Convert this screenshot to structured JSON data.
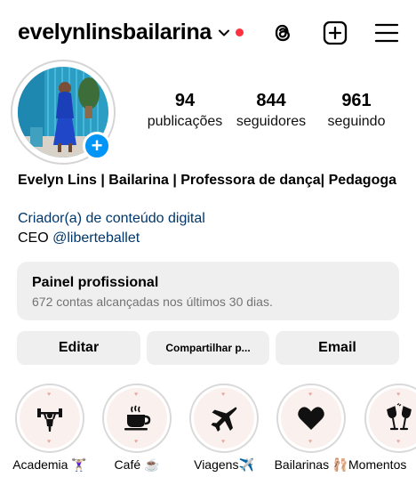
{
  "header": {
    "username": "evelynlinsbailarina",
    "icons": [
      "chevron-down-icon",
      "notification-dot",
      "threads-icon",
      "add-post-icon",
      "menu-icon"
    ],
    "accent_color": "#ff3040"
  },
  "profile": {
    "stats": [
      {
        "value": "94",
        "label": "publicações"
      },
      {
        "value": "844",
        "label": "seguidores"
      },
      {
        "value": "961",
        "label": "seguindo"
      }
    ],
    "add_story_symbol": "+",
    "bio": {
      "name": "Evelyn Lins | Bailarina | Professora de dança| Pedagoga",
      "category": "Criador(a) de conteúdo digital",
      "ceo_prefix": "CEO",
      "ceo_mention": "@liberteballet"
    }
  },
  "dashboard": {
    "title": "Painel profissional",
    "subtitle": "672 contas alcançadas nos últimos 30 dias."
  },
  "actions": {
    "edit": "Editar",
    "share": "Compartilhar p...",
    "email": "Email"
  },
  "highlights": [
    {
      "label": "Academia 🏋🏼‍♀️",
      "icon": "dumbbell-person-icon"
    },
    {
      "label": "Café ☕️",
      "icon": "coffee-cup-icon"
    },
    {
      "label": "Viagens✈️",
      "icon": "airplane-icon"
    },
    {
      "label": "Bailarinas 🩰",
      "icon": "heart-icon"
    },
    {
      "label": "Momentos",
      "icon": "toast-glasses-icon"
    }
  ],
  "colors": {
    "link": "#00376b",
    "badge_blue": "#0095f6",
    "panel_bg": "#efefef",
    "muted_text": "#737373"
  }
}
